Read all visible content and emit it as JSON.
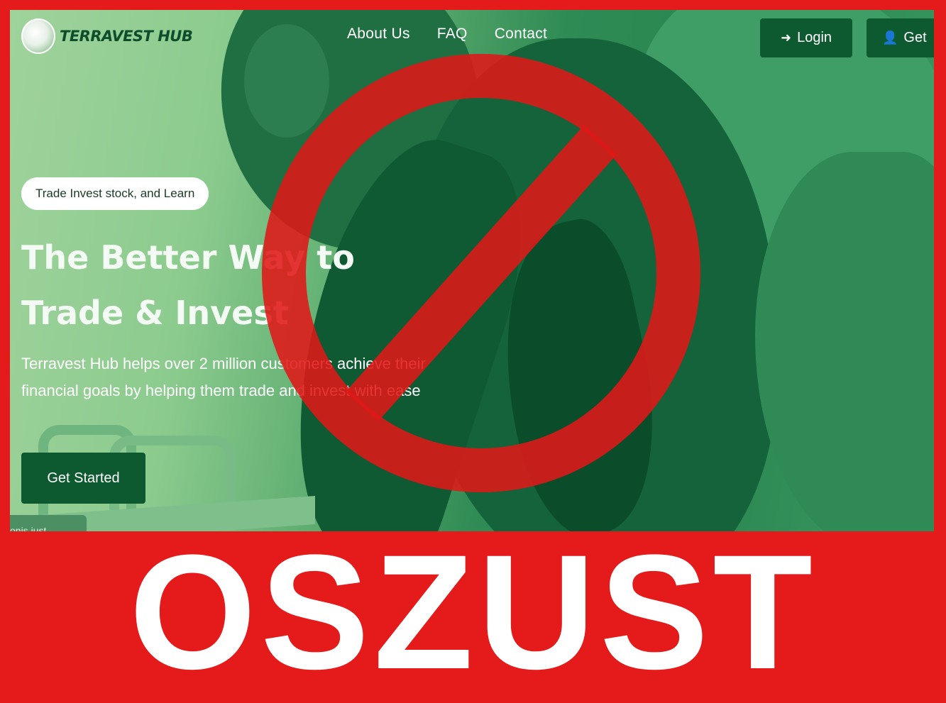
{
  "brand": {
    "name": "TERRAVEST HUB",
    "logo_icon": "lion-icon"
  },
  "nav": {
    "items": [
      "About Us",
      "FAQ",
      "Contact"
    ]
  },
  "header_buttons": {
    "login_label": "Login",
    "login_icon": "sign-in-icon",
    "get_label": "Get",
    "get_icon": "user-plus-icon"
  },
  "hero": {
    "pill": "Trade Invest stock, and Learn",
    "title_line1": "The Better Way to",
    "title_line2": "Trade & Invest",
    "description": "Terravest Hub helps over 2 million customers achieve their financial goals by helping them trade and invest with ease",
    "cta": "Get Started"
  },
  "toast": {
    "text": "onis just"
  },
  "overlay": {
    "sign": "prohibition-sign-icon",
    "warning": "OSZUST"
  },
  "colors": {
    "accent": "#0d5a30",
    "warning_red": "#e51a1a"
  }
}
